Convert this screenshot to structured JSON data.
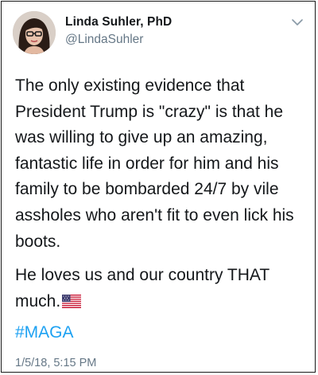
{
  "tweet": {
    "author_name": "Linda Suhler, PhD",
    "author_handle": "@LindaSuhler",
    "paragraph_1": "The only existing evidence that President Trump is \"crazy\" is that he was willing to give up an amazing, fantastic life in order for him and his family to be bombarded 24/7 by vile assholes who aren't fit to even lick his boots.",
    "paragraph_2": "He loves us and our country THAT much.",
    "paragraph_2_emoji": "us-flag-icon",
    "hashtag": "#MAGA",
    "timestamp": "1/5/18, 5:15 PM"
  },
  "icons": {
    "menu": "chevron-down-icon",
    "avatar": "profile-photo"
  },
  "colors": {
    "text": "#14171a",
    "secondary_text": "#657786",
    "link": "#1da1f2",
    "border": "#1a1a1a"
  }
}
